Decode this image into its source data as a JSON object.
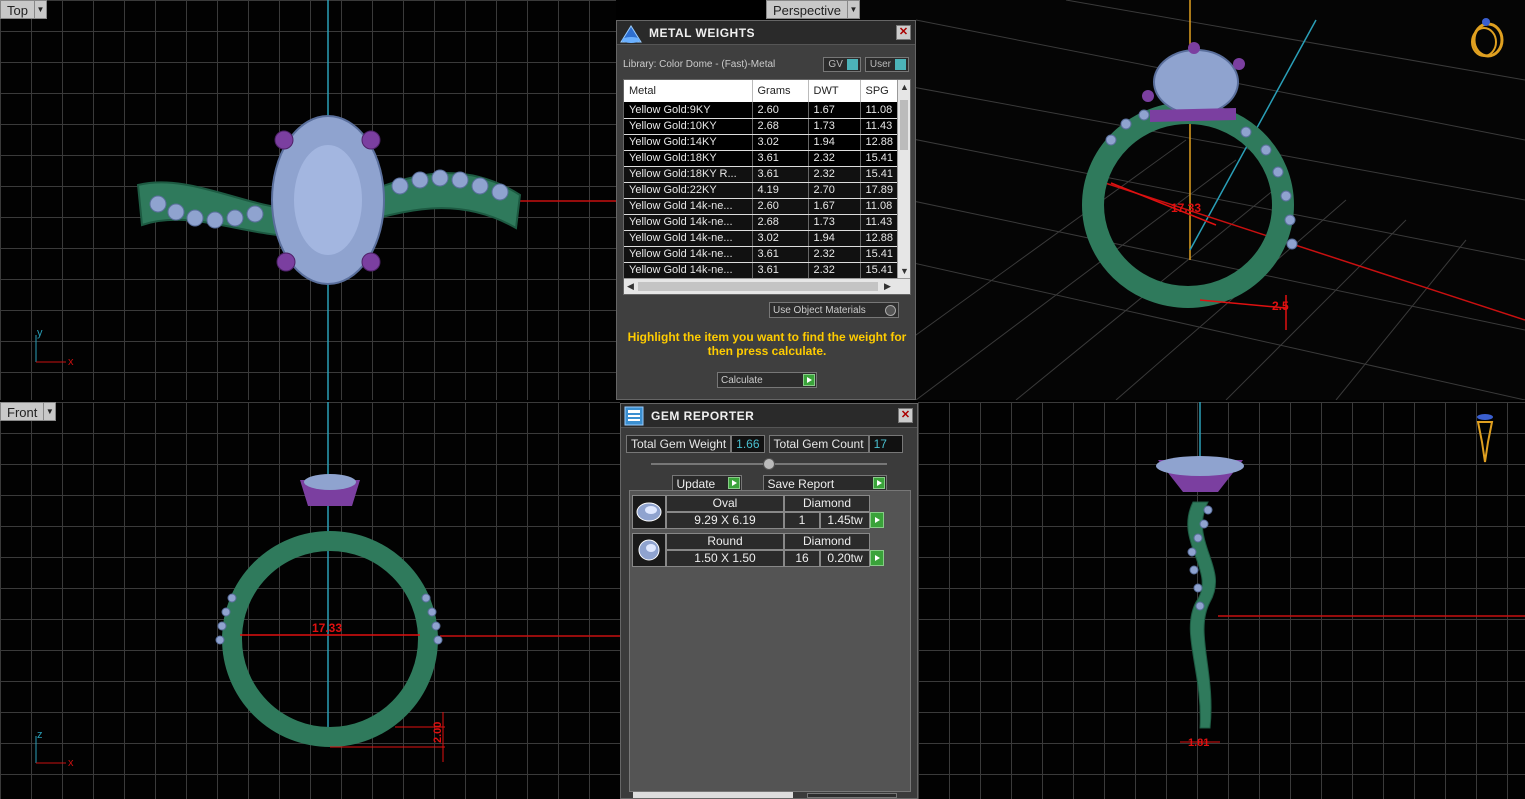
{
  "viewports": {
    "top": {
      "label": "Top",
      "axis_v": "y",
      "axis_h": "x"
    },
    "perspective": {
      "label": "Perspective",
      "measure_main": "17.33",
      "measure_side": "2.5"
    },
    "front": {
      "label": "Front",
      "axis_v": "z",
      "axis_h": "x",
      "measure_main": "17.33",
      "measure_side": "2.00"
    },
    "right": {
      "measure_bottom": "1.81"
    }
  },
  "metal_weights": {
    "title": "METAL WEIGHTS",
    "library": "Library: Color Dome - (Fast)-Metal",
    "toggle_gv": "GV",
    "toggle_user": "User",
    "columns": [
      "Metal",
      "Grams",
      "DWT",
      "SPG"
    ],
    "rows": [
      [
        "Yellow Gold:9KY",
        "2.60",
        "1.67",
        "11.08"
      ],
      [
        "Yellow Gold:10KY",
        "2.68",
        "1.73",
        "11.43"
      ],
      [
        "Yellow Gold:14KY",
        "3.02",
        "1.94",
        "12.88"
      ],
      [
        "Yellow Gold:18KY",
        "3.61",
        "2.32",
        "15.41"
      ],
      [
        "Yellow Gold:18KY R...",
        "3.61",
        "2.32",
        "15.41"
      ],
      [
        "Yellow Gold:22KY",
        "4.19",
        "2.70",
        "17.89"
      ],
      [
        "Yellow Gold 14k-ne...",
        "2.60",
        "1.67",
        "11.08"
      ],
      [
        "Yellow Gold 14k-ne...",
        "2.68",
        "1.73",
        "11.43"
      ],
      [
        "Yellow Gold 14k-ne...",
        "3.02",
        "1.94",
        "12.88"
      ],
      [
        "Yellow Gold 14k-ne...",
        "3.61",
        "2.32",
        "15.41"
      ],
      [
        "Yellow Gold 14k-ne...",
        "3.61",
        "2.32",
        "15.41"
      ]
    ],
    "use_object_materials": "Use Object Materials",
    "hint": "Highlight the item you want to find the weight for then press calculate.",
    "calculate": "Calculate"
  },
  "gem_reporter": {
    "title": "GEM REPORTER",
    "total_weight_label": "Total Gem Weight",
    "total_weight": "1.66",
    "total_count_label": "Total Gem Count",
    "total_count": "17",
    "update": "Update",
    "save_report": "Save Report",
    "gems": [
      {
        "shape": "Oval",
        "stone": "Diamond",
        "size": "9.29 X 6.19",
        "qty": "1",
        "weight": "1.45tw"
      },
      {
        "shape": "Round",
        "stone": "Diamond",
        "size": "1.50 X 1.50",
        "qty": "16",
        "weight": "0.20tw"
      }
    ]
  },
  "colors": {
    "band": "#2f7a5c",
    "prong": "#7b3fa0",
    "gem": "#8fa3cf",
    "accent_yellow": "#ffcc00",
    "value_cyan": "#4ac0d0",
    "dimension_red": "#e01010"
  }
}
